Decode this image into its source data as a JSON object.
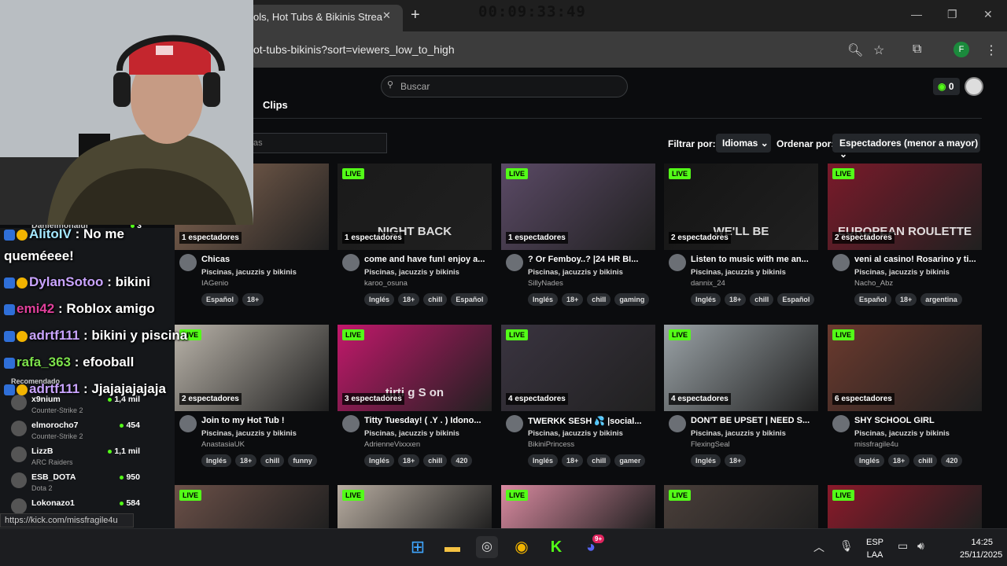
{
  "browser": {
    "tab_title": "ols, Hot Tubs & Bikinis Strea",
    "timer": "00:09:33:49",
    "url": "ot-tubs-bikinis?sort=viewers_low_to_high",
    "profile_initial": "F",
    "status_url": "https://kick.com/missfragile4u"
  },
  "site": {
    "search_placeholder": "Buscar",
    "kcoins": "0",
    "clips_tab": "Clips",
    "tag_filter_placeholder": "as",
    "filter_label": "Filtrar por:",
    "language_filter": "Idiomas",
    "sort_label": "Ordenar por:",
    "sort_value": "Espectadores (menor a mayor)",
    "live_label": "LIVE"
  },
  "streams": [
    {
      "viewers": "1 espectadores",
      "title": "Chicas",
      "category": "Piscinas, jacuzzis y bikinis",
      "user": "IAGenio",
      "tags": [
        "Español",
        "18+"
      ],
      "thumb_color": "#8a6a55"
    },
    {
      "viewers": "1 espectadores",
      "title": "come and have fun! enjoy a...",
      "category": "Piscinas, jacuzzis y bikinis",
      "user": "karoo_osuna",
      "tags": [
        "Inglés",
        "18+",
        "chill",
        "Español"
      ],
      "thumb_color": "#1a1a1a",
      "thumb_text": "NIGHT BACK"
    },
    {
      "viewers": "1 espectadores",
      "title": "? Or Femboy..? |24 HR BI...",
      "category": "Piscinas, jacuzzis y bikinis",
      "user": "SillyNades",
      "tags": [
        "Inglés",
        "18+",
        "chill",
        "gaming"
      ],
      "thumb_color": "#5b4a66"
    },
    {
      "viewers": "2 espectadores",
      "title": "Listen to music with me an...",
      "category": "Piscinas, jacuzzis y bikinis",
      "user": "dannix_24",
      "tags": [
        "Inglés",
        "18+",
        "chill",
        "Español"
      ],
      "thumb_color": "#141414",
      "thumb_text": "WE'LL BE"
    },
    {
      "viewers": "2 espectadores",
      "title": "veni al casino! Rosarino y ti...",
      "category": "Piscinas, jacuzzis y bikinis",
      "user": "Nacho_Abz",
      "tags": [
        "Español",
        "18+",
        "argentina"
      ],
      "thumb_color": "#7a1a2a",
      "thumb_text": "EUROPEAN ROULETTE"
    },
    {
      "viewers": "2 espectadores",
      "title": "Join to my Hot Tub !",
      "category": "Piscinas, jacuzzis y bikinis",
      "user": "AnastasiaUK",
      "tags": [
        "Inglés",
        "18+",
        "chill",
        "funny"
      ],
      "thumb_color": "#b9b3a9"
    },
    {
      "viewers": "3 espectadores",
      "title": "Titty Tuesday! ( .Y . ) Idono...",
      "category": "Piscinas, jacuzzis y bikinis",
      "user": "AdrienneVixxxen",
      "tags": [
        "Inglés",
        "18+",
        "chill",
        "420"
      ],
      "thumb_color": "#c2186b",
      "thumb_text": "tirti g S on"
    },
    {
      "viewers": "4 espectadores",
      "title": "TWERKK SESH 💦 |social...",
      "category": "Piscinas, jacuzzis y bikinis",
      "user": "BikiniPrincess",
      "tags": [
        "Inglés",
        "18+",
        "chill",
        "gamer"
      ],
      "thumb_color": "#3a3440"
    },
    {
      "viewers": "4 espectadores",
      "title": "DON'T BE UPSET | NEED S...",
      "category": "Piscinas, jacuzzis y bikinis",
      "user": "FlexingSeal",
      "tags": [
        "Inglés",
        "18+"
      ],
      "thumb_color": "#9aa2a6"
    },
    {
      "viewers": "6 espectadores",
      "title": "SHY SCHOOL GIRL",
      "category": "Piscinas, jacuzzis y bikinis",
      "user": "missfragile4u",
      "tags": [
        "Inglés",
        "18+",
        "chill",
        "420"
      ],
      "thumb_color": "#6b3a2e"
    },
    {
      "thumb_color": "#6b5048"
    },
    {
      "thumb_color": "#b8ada1"
    },
    {
      "thumb_color": "#d98aa0"
    },
    {
      "thumb_color": "#4a3f3a"
    },
    {
      "thumb_color": "#8a1a2a"
    }
  ],
  "sidebar": {
    "partial_top_name": "Danielmonalui",
    "partial_top_count": "3",
    "recommended_label": "Recomendado",
    "recommended": [
      {
        "name": "x9nium",
        "game": "Counter-Strike 2",
        "count": "1,4 mil"
      },
      {
        "name": "elmorocho7",
        "game": "Counter-Strike 2",
        "count": "454"
      },
      {
        "name": "LizzB",
        "game": "ARC Raiders",
        "count": "1,1 mil"
      },
      {
        "name": "ESB_DOTA",
        "game": "Dota 2",
        "count": "950"
      },
      {
        "name": "Lokonazo1",
        "game": "",
        "count": "584"
      }
    ]
  },
  "chat": [
    {
      "user": "AlitoIV",
      "msg": ": No me"
    },
    {
      "user": "",
      "msg": "queméeee!"
    },
    {
      "user": "DylanSotoo",
      "msg": ": bikini"
    },
    {
      "user": "emi42",
      "msg": ": Roblox amigo"
    },
    {
      "user": "adrtf111",
      "msg": ": bikini y piscina"
    },
    {
      "user": "rafa_363",
      "msg": ": efooball"
    },
    {
      "user": "adrtf111",
      "msg": ": Jjajajajajaja"
    }
  ],
  "taskbar": {
    "lang_top": "ESP",
    "lang_bottom": "LAA",
    "time": "14:25",
    "date": "25/11/2025",
    "discord_badge": "9+"
  },
  "colors": {
    "accent": "#53fc18",
    "bg": "#0b0c0e"
  }
}
